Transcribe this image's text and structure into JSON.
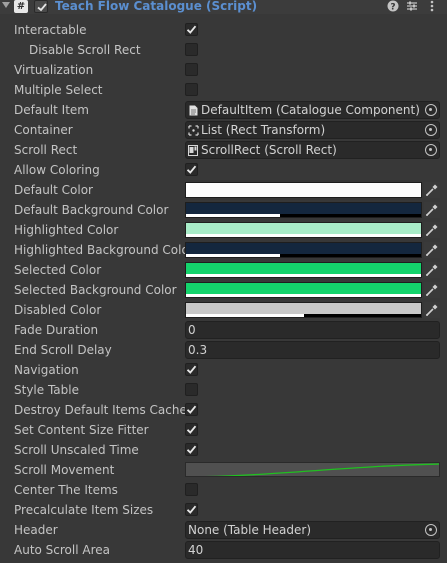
{
  "component": {
    "title": "Teach Flow Catalogue (Script)",
    "script_icon_glyph": "#",
    "enabled": true,
    "header_icons": [
      "help-icon",
      "presets-icon",
      "context-menu-icon"
    ]
  },
  "properties": {
    "interactable": {
      "label": "Interactable",
      "checked": true
    },
    "disable_scroll_rect": {
      "label": "Disable Scroll Rect",
      "checked": false
    },
    "virtualization": {
      "label": "Virtualization",
      "checked": false
    },
    "multiple_select": {
      "label": "Multiple Select",
      "checked": false
    },
    "default_item": {
      "label": "Default Item",
      "value": "DefaultItem (Catalogue Component)",
      "icon": "script-file-icon"
    },
    "container": {
      "label": "Container",
      "value": "List (Rect Transform)",
      "icon": "rect-transform-icon"
    },
    "scroll_rect": {
      "label": "Scroll Rect",
      "value": "ScrollRect (Scroll Rect)",
      "icon": "scroll-rect-icon"
    },
    "allow_coloring": {
      "label": "Allow Coloring",
      "checked": true
    },
    "default_color": {
      "label": "Default Color",
      "color": "#ffffff",
      "alpha": 1.0
    },
    "default_background_color": {
      "label": "Default Background Color",
      "color": "#14273e",
      "alpha": 0.4
    },
    "highlighted_color": {
      "label": "Highlighted Color",
      "color": "#a8ecc8",
      "alpha": 1.0
    },
    "highlighted_background_color": {
      "label": "Highlighted Background Color",
      "color": "#14273e",
      "alpha": 0.4
    },
    "selected_color": {
      "label": "Selected Color",
      "color": "#14d46c",
      "alpha": 1.0
    },
    "selected_background_color": {
      "label": "Selected Background Color",
      "color": "#14d46c",
      "alpha": 1.0
    },
    "disabled_color": {
      "label": "Disabled Color",
      "color": "#c8c8c8",
      "alpha": 0.5
    },
    "fade_duration": {
      "label": "Fade Duration",
      "value": "0"
    },
    "end_scroll_delay": {
      "label": "End Scroll Delay",
      "value": "0.3"
    },
    "navigation": {
      "label": "Navigation",
      "checked": true
    },
    "style_table": {
      "label": "Style Table",
      "checked": false
    },
    "destroy_default_items_cache": {
      "label": "Destroy Default Items Cache",
      "checked": true
    },
    "set_content_size_fitter": {
      "label": "Set Content Size Fitter",
      "checked": true
    },
    "scroll_unscaled_time": {
      "label": "Scroll Unscaled Time",
      "checked": true
    },
    "scroll_movement": {
      "label": "Scroll Movement",
      "curve_color": "#20c020"
    },
    "center_the_items": {
      "label": "Center The Items",
      "checked": false
    },
    "precalculate_item_sizes": {
      "label": "Precalculate Item Sizes",
      "checked": true
    },
    "header": {
      "label": "Header",
      "value": "None (Table Header)"
    },
    "auto_scroll_area": {
      "label": "Auto Scroll Area",
      "value": "40"
    }
  }
}
